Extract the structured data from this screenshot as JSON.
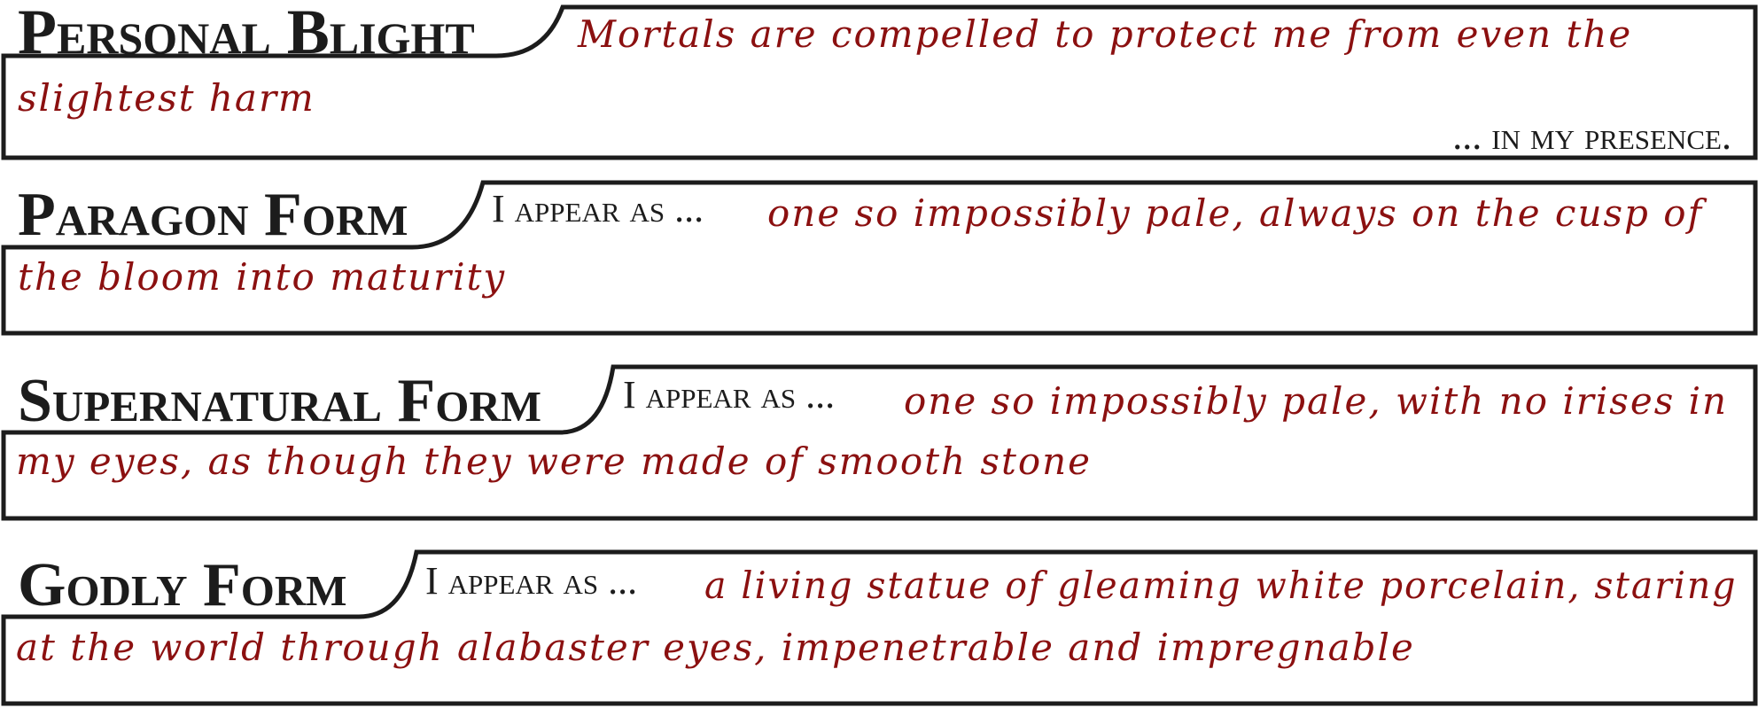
{
  "panels": [
    {
      "heading": "Personal Blight",
      "prefix": "",
      "line1": "Mortals are compelled to protect me from even the",
      "line2": "slightest harm",
      "suffix": "... in my presence."
    },
    {
      "heading": "Paragon Form",
      "prefix": "I appear as ...",
      "line1": "one so impossibly pale, always on the cusp of",
      "line2": "the bloom into maturity",
      "suffix": ""
    },
    {
      "heading": "Supernatural Form",
      "prefix": "I appear as ...",
      "line1": "one so impossibly pale, with no irises in",
      "line2": "my eyes, as though they were made of smooth stone",
      "suffix": ""
    },
    {
      "heading": "Godly Form",
      "prefix": "I appear as ...",
      "line1": "a living statue of gleaming white porcelain, staring",
      "line2": "at the world through alabaster eyes, impenetrable and impregnable",
      "suffix": ""
    }
  ],
  "colors": {
    "ink": "#1c1c1c",
    "handwriting": "#8b1010",
    "frame": "#1c1c1c"
  }
}
